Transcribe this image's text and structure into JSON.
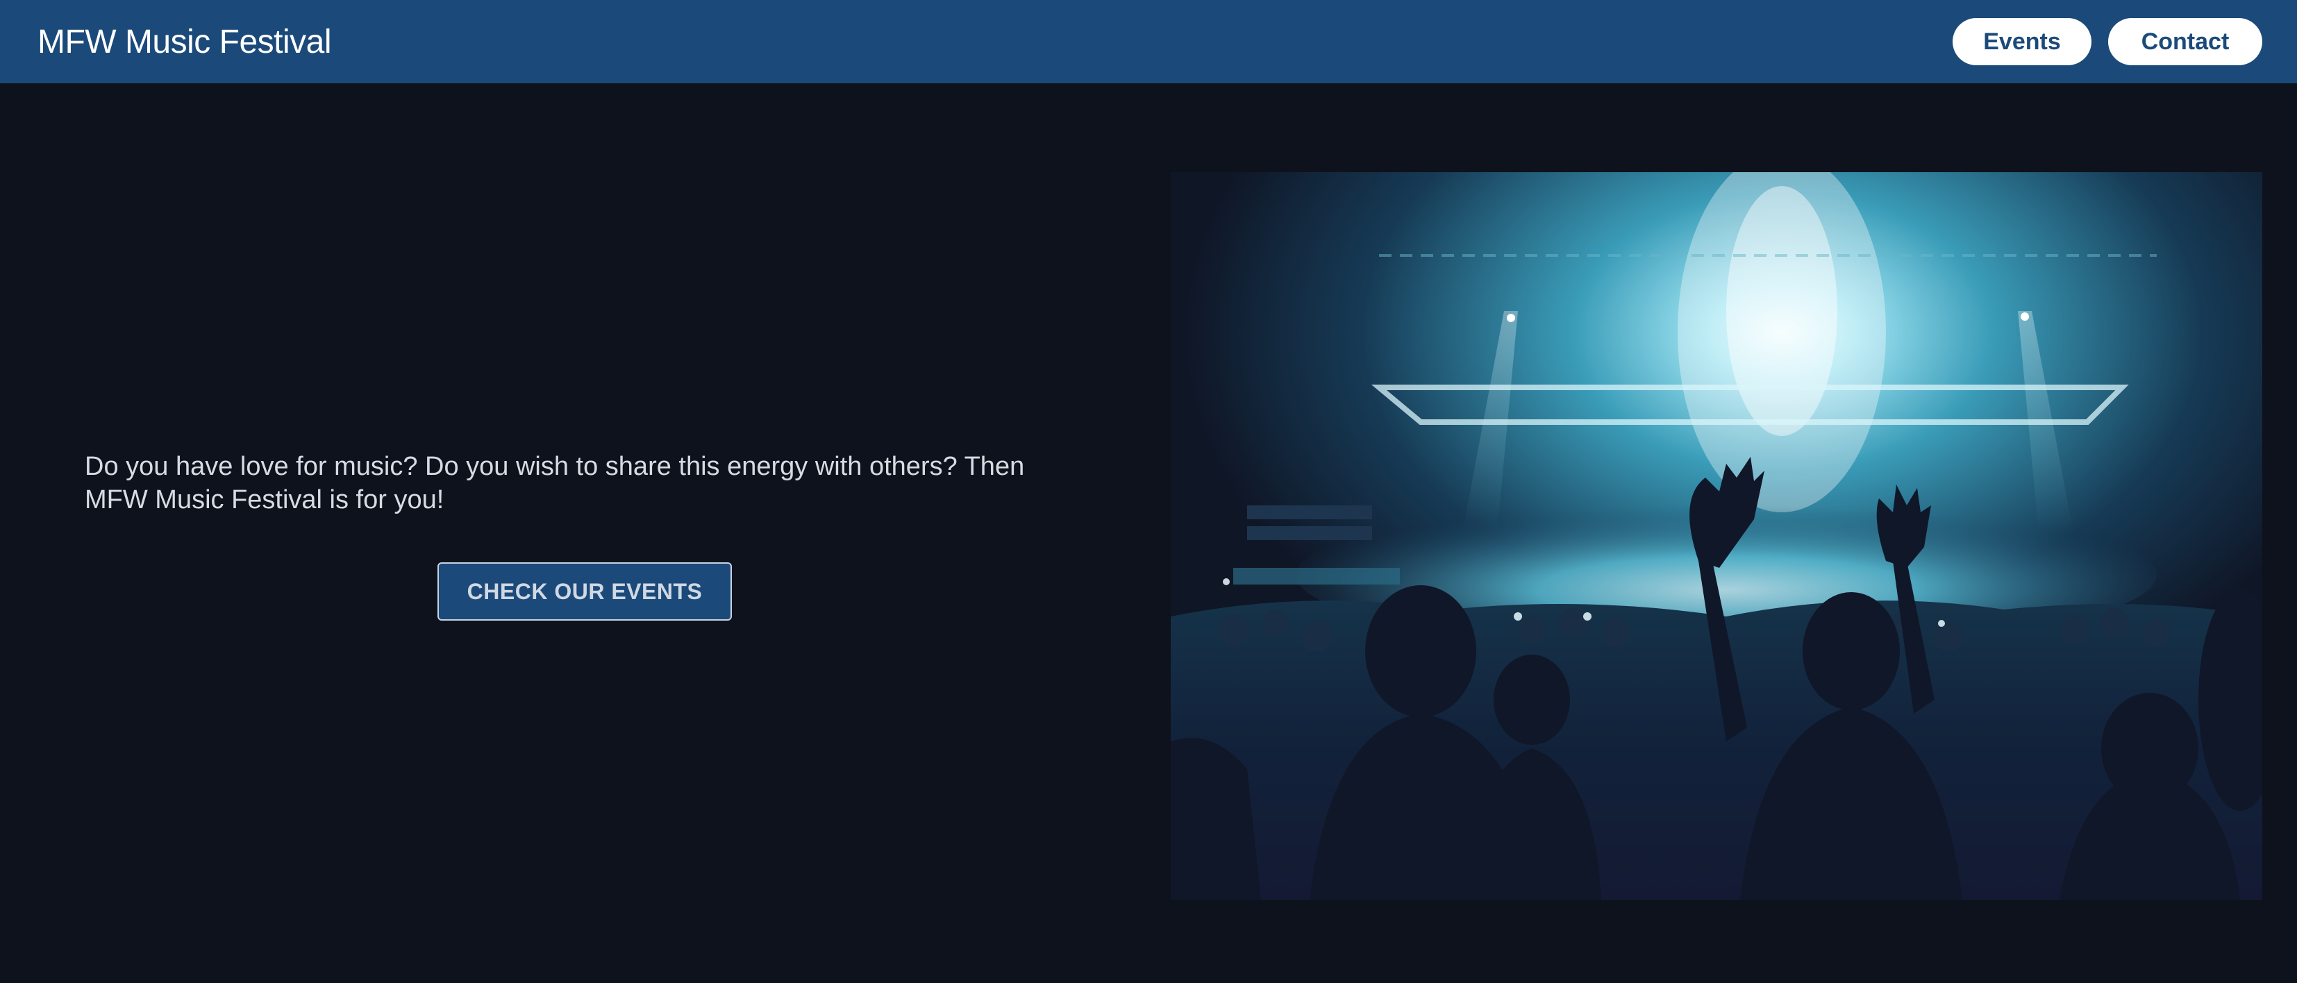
{
  "header": {
    "title": "MFW Music Festival",
    "nav": [
      {
        "label": "Events"
      },
      {
        "label": "Contact"
      }
    ]
  },
  "hero": {
    "text": "Do you have love for music? Do you wish to share this energy with others? Then MFW Music Festival is for you!",
    "cta_label": "CHECK OUR EVENTS"
  },
  "colors": {
    "header_bg": "#1b4a7a",
    "page_bg": "#0e121c",
    "text_light": "#d7dbe2",
    "stage_light": "#7fd8ea"
  },
  "image": {
    "subject": "concert crowd with raised hands silhouetted against bright stage lights"
  }
}
